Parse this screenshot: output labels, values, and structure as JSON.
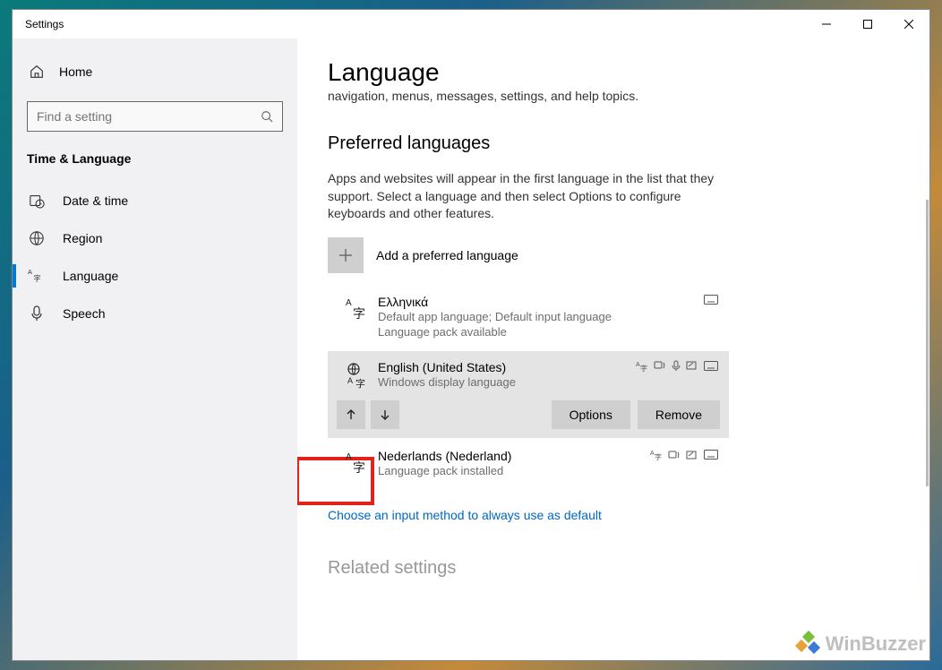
{
  "titlebar": {
    "title": "Settings"
  },
  "sidebar": {
    "home_label": "Home",
    "search_placeholder": "Find a setting",
    "category": "Time & Language",
    "items": [
      {
        "label": "Date & time",
        "icon": "clock-calendar-icon"
      },
      {
        "label": "Region",
        "icon": "globe-icon"
      },
      {
        "label": "Language",
        "icon": "language-a-icon"
      },
      {
        "label": "Speech",
        "icon": "microphone-icon"
      }
    ],
    "active_index": 2
  },
  "main": {
    "page_title": "Language",
    "truncated_line": "navigation, menus, messages, settings, and help topics.",
    "section_title": "Preferred languages",
    "section_desc": "Apps and websites will appear in the first language in the list that they support. Select a language and then select Options to configure keyboards and other features.",
    "add_language_label": "Add a preferred language",
    "languages": [
      {
        "name": "Ελληνικά",
        "status_line1": "Default app language; Default input language",
        "status_line2": "Language pack available",
        "badges": [
          "keyboard"
        ],
        "selected": false
      },
      {
        "name": "English (United States)",
        "status_line1": "Windows display language",
        "status_line2": "",
        "badges": [
          "lang-a",
          "tts",
          "mic",
          "handwrite",
          "keyboard"
        ],
        "selected": true
      },
      {
        "name": "Nederlands (Nederland)",
        "status_line1": "Language pack installed",
        "status_line2": "",
        "badges": [
          "lang-a",
          "tts",
          "handwrite",
          "keyboard"
        ],
        "selected": false
      }
    ],
    "options_btn": "Options",
    "remove_btn": "Remove",
    "input_method_link": "Choose an input method to always use as default",
    "related_heading": "Related settings"
  },
  "watermark": "WinBuzzer"
}
